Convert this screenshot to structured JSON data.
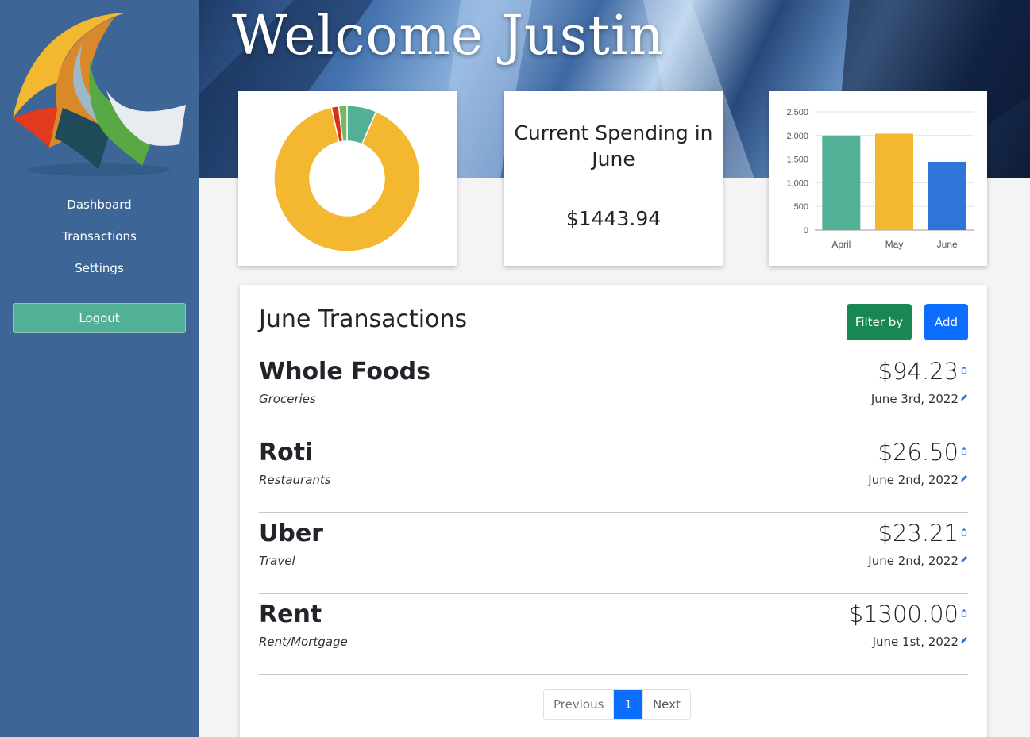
{
  "sidebar": {
    "nav": [
      "Dashboard",
      "Transactions",
      "Settings"
    ],
    "logout_label": "Logout"
  },
  "hero": {
    "title": "Welcome Justin"
  },
  "spending_card": {
    "title": "Current Spending in June",
    "amount": "$1443.94"
  },
  "colors": {
    "sidebar": "#3d6596",
    "teal": "#52b096",
    "yellow": "#f3b82f",
    "blue": "#2f74d6",
    "red": "#d6301f",
    "green": "#7bb661",
    "filter_button": "#198754",
    "add_button": "#0d6efd"
  },
  "chart_data": [
    {
      "type": "pie",
      "style": "donut",
      "slices": [
        {
          "name": "Rent/Mortgage",
          "value": 1300.0,
          "color": "#f3b82f"
        },
        {
          "name": "Groceries",
          "value": 94.23,
          "color": "#52b096"
        },
        {
          "name": "Restaurants",
          "value": 26.5,
          "color": "#7bb661"
        },
        {
          "name": "Travel",
          "value": 23.21,
          "color": "#d6301f"
        }
      ]
    },
    {
      "type": "bar",
      "categories": [
        "April",
        "May",
        "June"
      ],
      "values": [
        2000,
        2040,
        1443.94
      ],
      "colors": [
        "#52b096",
        "#f3b82f",
        "#2f74d6"
      ],
      "ylim": [
        0,
        2500
      ],
      "yticks": [
        "0",
        "500",
        "1,000",
        "1,500",
        "2,000",
        "2,500"
      ],
      "grid": true
    }
  ],
  "transactions": {
    "title": "June Transactions",
    "filter_label": "Filter by",
    "add_label": "Add",
    "items": [
      {
        "name": "Whole Foods",
        "category": "Groceries",
        "amount": "$94.23",
        "date": "June 3rd, 2022"
      },
      {
        "name": "Roti",
        "category": "Restaurants",
        "amount": "$26.50",
        "date": "June 2nd, 2022"
      },
      {
        "name": "Uber",
        "category": "Travel",
        "amount": "$23.21",
        "date": "June 2nd, 2022"
      },
      {
        "name": "Rent",
        "category": "Rent/Mortgage",
        "amount": "$1300.00",
        "date": "June 1st, 2022"
      }
    ],
    "pagination": {
      "previous": "Previous",
      "current": "1",
      "next": "Next"
    }
  }
}
